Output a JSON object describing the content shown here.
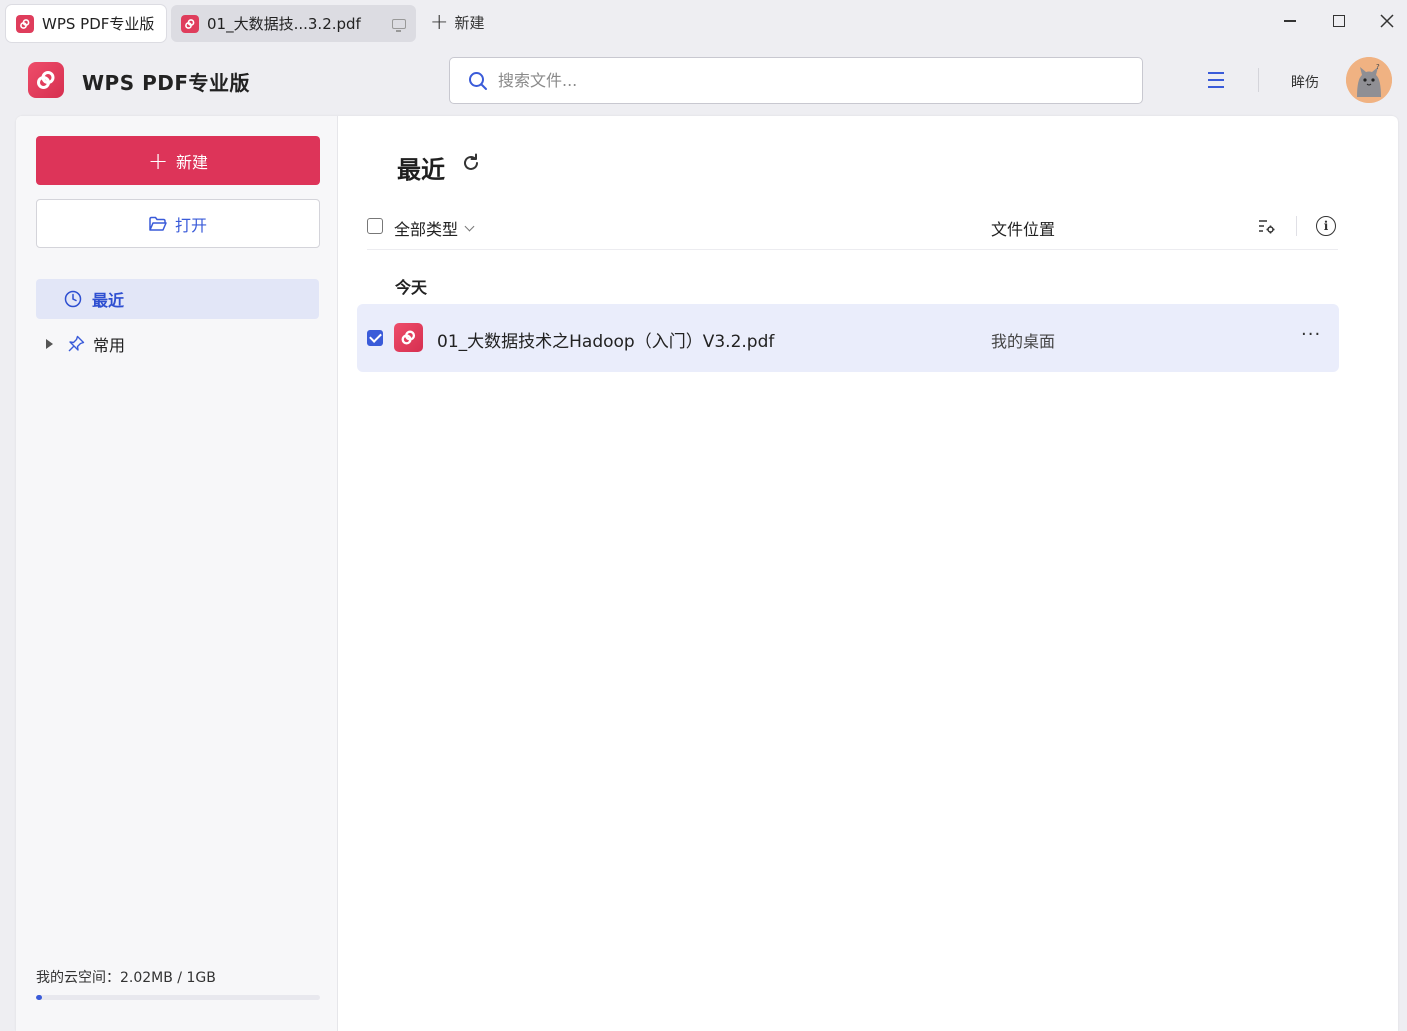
{
  "tabs": [
    {
      "label": "WPS PDF专业版",
      "active": true
    },
    {
      "label": "01_大数据技...3.2.pdf",
      "active": false
    }
  ],
  "new_tab_label": "新建",
  "app": {
    "name": "WPS PDF专业版"
  },
  "search": {
    "placeholder": "搜索文件..."
  },
  "user": {
    "name": "眸伤"
  },
  "sidebar": {
    "new_button": "新建",
    "open_button": "打开",
    "nav": [
      {
        "label": "最近",
        "selected": true
      },
      {
        "label": "常用",
        "selected": false
      }
    ],
    "storage": {
      "label": "我的云空间：2.02MB / 1GB",
      "used_fraction": 0.002
    }
  },
  "content": {
    "title": "最近",
    "filter_label": "全部类型",
    "location_header": "文件位置",
    "groups": [
      {
        "label": "今天",
        "files": [
          {
            "name": "01_大数据技术之Hadoop（入门）V3.2.pdf",
            "location": "我的桌面",
            "checked": true
          }
        ]
      }
    ]
  },
  "colors": {
    "brand_red": "#dd3459",
    "accent_blue": "#3a5bd9",
    "selected_bg": "#eaedfb"
  }
}
